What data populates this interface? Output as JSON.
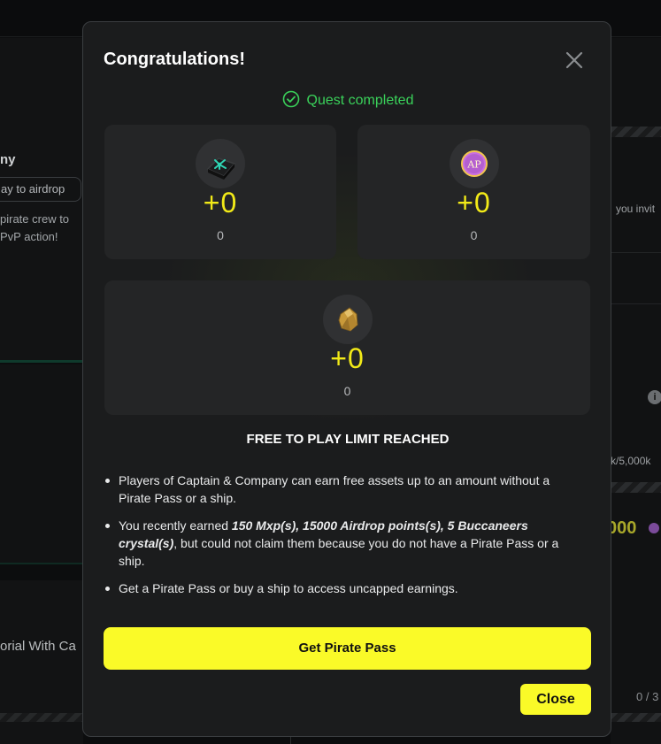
{
  "background": {
    "left_title": "ny",
    "left_pill": "ay to airdrop",
    "left_desc": "pirate crew to\nPvP action!",
    "left_tutorial": "orial With Ca",
    "right_text": "you invit",
    "right_count": "k/5,000k",
    "right_yellow": "000",
    "right_progress": "0 / 3",
    "right_info": "i"
  },
  "modal": {
    "title": "Congratulations!",
    "quest_status": "Quest completed",
    "rewards": [
      {
        "icon": "relic-chest-icon",
        "amount": "+0",
        "sub": "0"
      },
      {
        "icon": "airdrop-points-coin-icon",
        "icon_text": "AP",
        "amount": "+0",
        "sub": "0"
      },
      {
        "icon": "buccaneers-crystal-icon",
        "amount": "+0",
        "sub": "0"
      }
    ],
    "limit_heading": "FREE TO PLAY LIMIT REACHED",
    "bullets": {
      "b1": "Players of Captain & Company can earn free assets up to an amount without a Pirate Pass or a ship.",
      "b2_pre": "You recently earned ",
      "b2_bold": "150 Mxp(s), 15000 Airdrop points(s), 5 Buccaneers crystal(s)",
      "b2_post": ", but could not claim them because you do not have a Pirate Pass or a ship.",
      "b3": "Get a Pirate Pass or buy a ship to access uncapped earnings."
    },
    "primary_button": "Get Pirate Pass",
    "close_button": "Close"
  },
  "colors": {
    "accent_yellow": "#fafa28",
    "success_green": "#3ad15a",
    "modal_bg": "#1b1c1d",
    "card_bg": "#242526"
  }
}
